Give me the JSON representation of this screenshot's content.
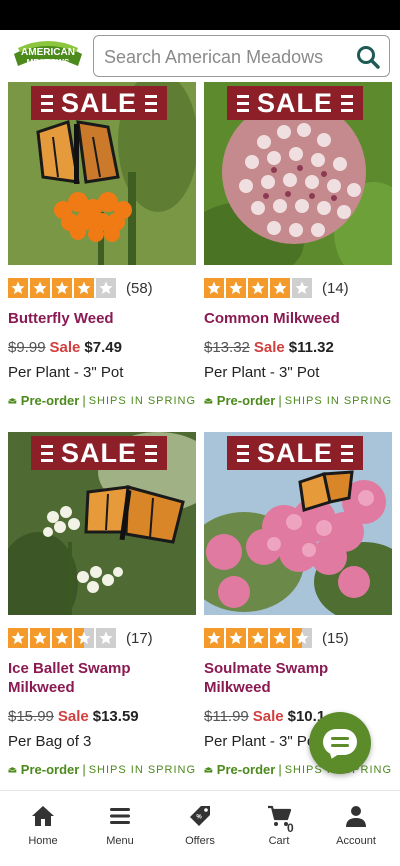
{
  "header": {
    "logo_text": "AMERICAN MEADOWS",
    "search_placeholder": "Search American Meadows"
  },
  "colors": {
    "brand_green": "#4c8a1c",
    "product_name": "#8a1a52",
    "sale_red": "#d1403e",
    "sale_banner": "#8d1f28",
    "star": "#f39a2b"
  },
  "products": [
    {
      "sale_label": "SALE",
      "rating": 4,
      "review_count": "(58)",
      "name": "Butterfly Weed",
      "old_price": "$9.99",
      "sale_word": "Sale",
      "new_price": "$7.49",
      "unit": "Per Plant - 3\" Pot",
      "preorder": "Pre-order",
      "ships": "SHIPS IN SPRING"
    },
    {
      "sale_label": "SALE",
      "rating": 4,
      "review_count": "(14)",
      "name": "Common Milkweed",
      "old_price": "$13.32",
      "sale_word": "Sale",
      "new_price": "$11.32",
      "unit": "Per Plant - 3\" Pot",
      "preorder": "Pre-order",
      "ships": "SHIPS IN SPRING"
    },
    {
      "sale_label": "SALE",
      "rating": 3.5,
      "review_count": "(17)",
      "name": "Ice Ballet Swamp Milkweed",
      "old_price": "$15.99",
      "sale_word": "Sale",
      "new_price": "$13.59",
      "unit": "Per Bag of 3",
      "preorder": "Pre-order",
      "ships": "SHIPS IN SPRING"
    },
    {
      "sale_label": "SALE",
      "rating": 4.5,
      "review_count": "(15)",
      "name": "Soulmate Swamp Milkweed",
      "old_price": "$11.99",
      "sale_word": "Sale",
      "new_price": "$10.1",
      "unit": "Per Plant - 3\" Po",
      "preorder": "Pre-order",
      "ships": "SHIPS IN SPRING"
    }
  ],
  "tabbar": {
    "home": "Home",
    "menu": "Menu",
    "offers": "Offers",
    "cart": "Cart",
    "cart_count": "0",
    "account": "Account"
  }
}
